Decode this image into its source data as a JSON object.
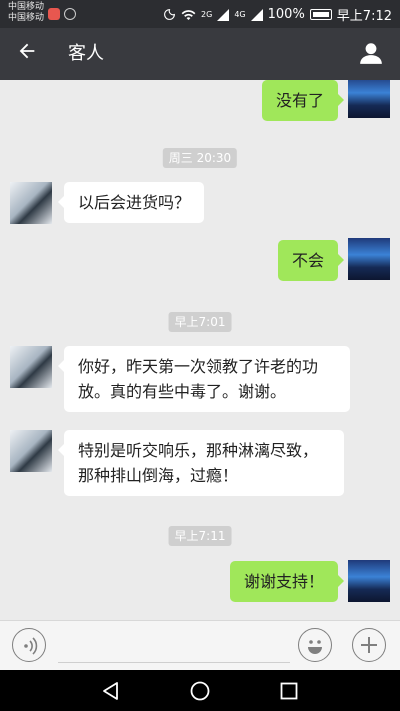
{
  "status_bar": {
    "carrier_1": "中国移动",
    "carrier_2": "中国移动",
    "network_1": "2G",
    "network_2": "4G",
    "battery": "100%",
    "time": "早上7:12"
  },
  "nav": {
    "title": "客人"
  },
  "messages": [
    {
      "side": "right",
      "text": "没有了"
    },
    {
      "type": "time",
      "text": "周三 20:30"
    },
    {
      "side": "left",
      "text": "以后会进货吗？"
    },
    {
      "side": "right",
      "text": "不会"
    },
    {
      "type": "time",
      "text": "早上7:01"
    },
    {
      "side": "left",
      "text": "你好，昨天第一次领教了许老的功放。真的有些中毒了。谢谢。"
    },
    {
      "side": "left",
      "text": "特别是听交响乐，那种淋漓尽致，那种排山倒海，过瘾！"
    },
    {
      "type": "time",
      "text": "早上7:11"
    },
    {
      "side": "right",
      "text": "谢谢支持！"
    }
  ],
  "input": {
    "placeholder": ""
  },
  "colors": {
    "nav_bg": "#393a3f",
    "status_bg": "#2c2d31",
    "chat_bg": "#ebebeb",
    "sent_bubble": "#a0e75a",
    "recv_bubble": "#ffffff"
  },
  "icons": [
    "back-arrow-icon",
    "profile-icon",
    "voice-icon",
    "emoji-icon",
    "plus-icon",
    "back-triangle-icon",
    "home-circle-icon",
    "recent-square-icon"
  ]
}
